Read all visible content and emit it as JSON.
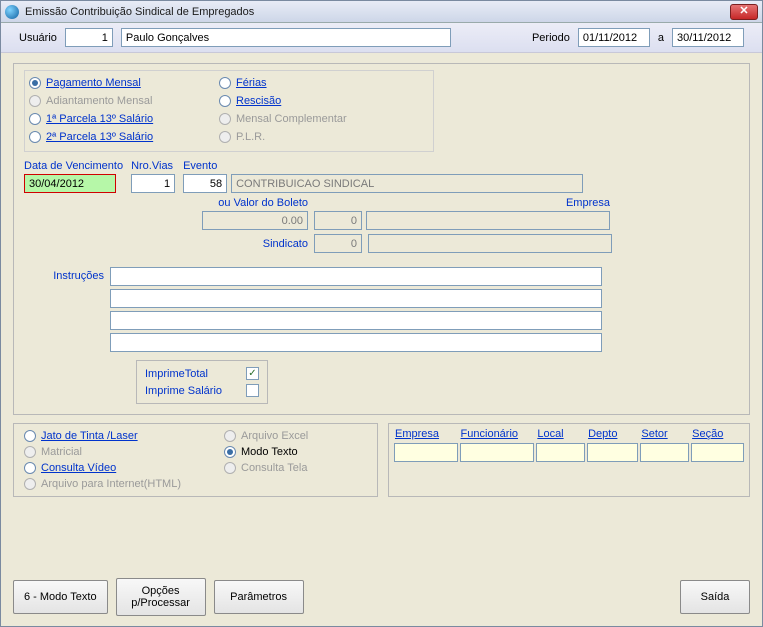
{
  "window": {
    "title": "Emissão Contribuição Sindical de Empregados"
  },
  "userbar": {
    "usuario_label": "Usuário",
    "usuario_id": "1",
    "usuario_nome": "Paulo Gonçalves",
    "periodo_label": "Periodo",
    "periodo_de": "01/11/2012",
    "periodo_a_label": "a",
    "periodo_ate": "30/11/2012"
  },
  "tipo": {
    "pag_mensal": "Pagamento Mensal",
    "adiant_mensal": "Adiantamento Mensal",
    "parc1_13": "1ª Parcela 13º Salário",
    "parc2_13": "2ª Parcela 13º Salário",
    "ferias": "Férias",
    "rescisao": "Rescisão",
    "mensal_comp": "Mensal Complementar",
    "plr": "P.L.R."
  },
  "campos": {
    "data_venc_label": "Data de Vencimento",
    "data_venc": "30/04/2012",
    "nro_vias_label": "Nro.Vias",
    "nro_vias": "1",
    "evento_label": "Evento",
    "evento_cod": "58",
    "evento_desc": "CONTRIBUICAO SINDICAL",
    "valor_boleto_label": "ou Valor do Boleto",
    "valor_boleto": "0.00",
    "empresa_label": "Empresa",
    "empresa_cod": "0",
    "empresa_desc": "",
    "sindicato_label": "Sindicato",
    "sindicato_cod": "0",
    "sindicato_desc": "",
    "instrucoes_label": "Instruções",
    "instr1": "",
    "instr2": "",
    "instr3": "",
    "instr4": "",
    "imprime_total_label": "ImprimeTotal",
    "imprime_salario_label": "Imprime Salário"
  },
  "saida": {
    "jato": "Jato de Tinta /Laser",
    "matricial": "Matricial",
    "consulta_video": "Consulta Vídeo",
    "arq_html": "Arquivo para Internet(HTML)",
    "arq_excel": "Arquivo Excel",
    "modo_texto": "Modo Texto",
    "consulta_tela": "Consulta Tela"
  },
  "filters": {
    "empresa": "Empresa",
    "funcionario": "Funcionário",
    "local": "Local",
    "depto": "Depto",
    "setor": "Setor",
    "secao": "Seção"
  },
  "buttons": {
    "modo_texto": "6 - Modo Texto",
    "opcoes": "Opções p/Processar",
    "parametros": "Parâmetros",
    "saida": "Saída"
  }
}
